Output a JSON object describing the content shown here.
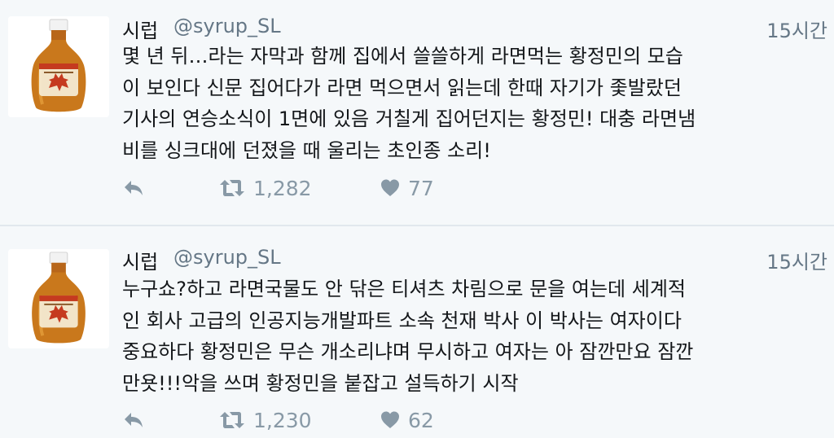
{
  "colors": {
    "background": "#f5f8fa",
    "text_primary": "#14171a",
    "text_secondary": "#657786",
    "action_icon": "#8899a6",
    "divider": "#e1e8ed",
    "syrup_amber": "#c9781c",
    "label_red": "#c53a1f"
  },
  "icons": {
    "reply": "reply-icon",
    "retweet": "retweet-icon",
    "like": "heart-icon",
    "avatar": "maple-syrup-bottle-avatar"
  },
  "tweets": [
    {
      "display_name": "시럽",
      "username": "@syrup_SL",
      "timestamp": "15시간",
      "text_lines": [
        "몇 년 뒤…라는 자막과 함께 집에서 쓸쓸하게 라면먹는 황정민의 모습",
        "이 보인다 신문 집어다가 라면 먹으면서 읽는데 한때 자기가 좇발랐던",
        "기사의 연승소식이 1면에 있음 거칠게 집어던지는 황정민! 대충 라면냄",
        "비를 싱크대에 던졌을 때 울리는 초인종 소리!"
      ],
      "retweet_count": "1,282",
      "like_count": "77"
    },
    {
      "display_name": "시럽",
      "username": "@syrup_SL",
      "timestamp": "15시간",
      "text_lines": [
        "누구쇼?하고 라면국물도 안 닦은 티셔츠 차림으로 문을 여는데 세계적",
        "인 회사 고급의 인공지능개발파트 소속 천재 박사 이 박사는 여자이다",
        "중요하다 황정민은 무슨 개소리냐며 무시하고 여자는 아 잠깐만요 잠깐",
        "만욧!!!악을 쓰며 황정민을 붙잡고 설득하기 시작"
      ],
      "retweet_count": "1,230",
      "like_count": "62"
    }
  ]
}
